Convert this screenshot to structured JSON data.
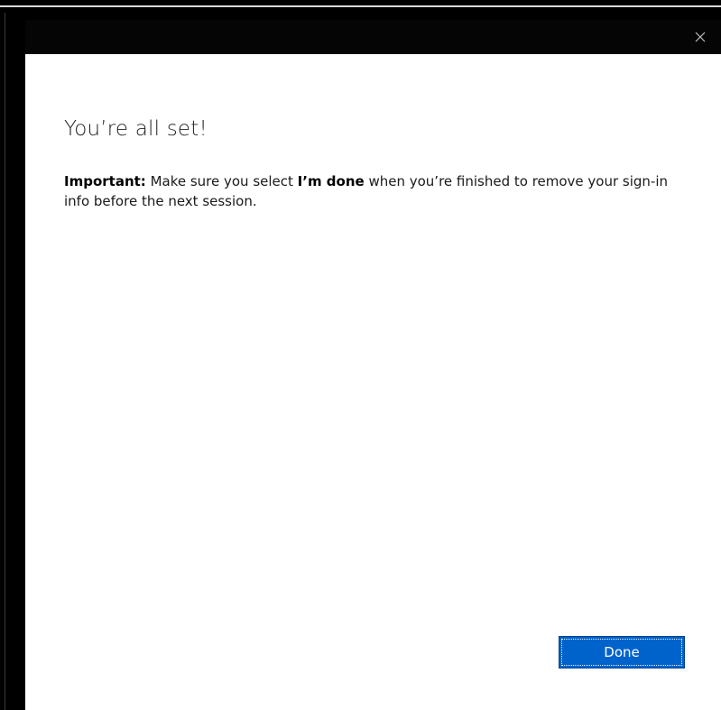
{
  "dialog": {
    "close_icon": "close-icon",
    "heading": "You’re all set!",
    "message": {
      "important_label": "Important:",
      "text_before": " Make sure you select ",
      "emphasis": "I’m done",
      "text_after": " when you’re finished to remove your sign-in info before the next session."
    },
    "done_button": "Done"
  },
  "colors": {
    "titlebar": "#050505",
    "content_background": "#ffffff",
    "button_background": "#0063cc",
    "button_text": "#ffffff"
  }
}
